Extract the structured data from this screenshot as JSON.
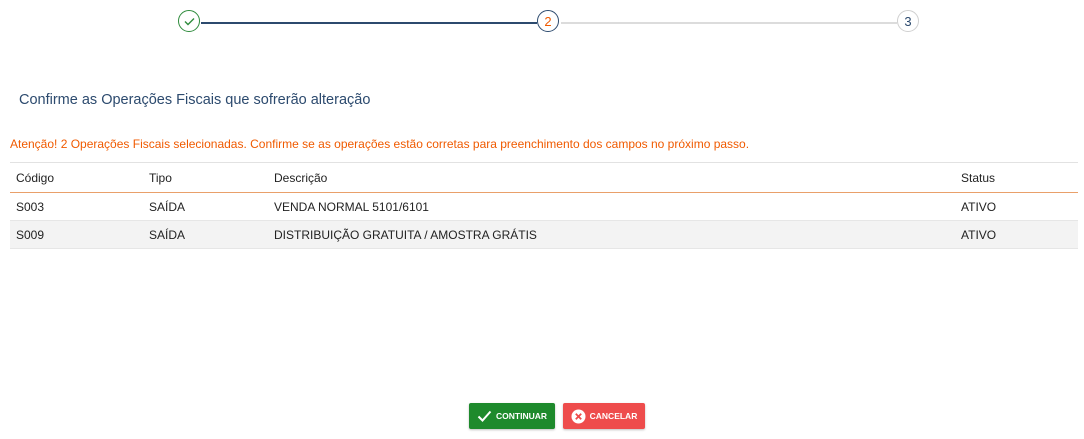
{
  "stepper": {
    "step2_label": "2",
    "step3_label": "3"
  },
  "title": "Confirme as Operações Fiscais que sofrerão alteração",
  "warning": "Atenção! 2 Operações Fiscais selecionadas. Confirme se as operações estão corretas para preenchimento dos campos no próximo passo.",
  "table": {
    "headers": [
      "Código",
      "Tipo",
      "Descrição",
      "Status"
    ],
    "rows": [
      [
        "S003",
        "SAÍDA",
        "VENDA NORMAL 5101/6101",
        "ATIVO"
      ],
      [
        "S009",
        "SAÍDA",
        "DISTRIBUIÇÃO GRATUITA / AMOSTRA GRÁTIS",
        "ATIVO"
      ]
    ]
  },
  "buttons": {
    "continue_label": "CONTINUAR",
    "cancel_label": "CANCELAR"
  },
  "colors": {
    "accent": "#f05a00",
    "title": "#2c4a6e",
    "continue": "#1e8a2c",
    "cancel": "#ee4c4c"
  },
  "icons": {
    "step1": "check-icon",
    "continue": "check-icon",
    "cancel": "close-circle-icon"
  }
}
